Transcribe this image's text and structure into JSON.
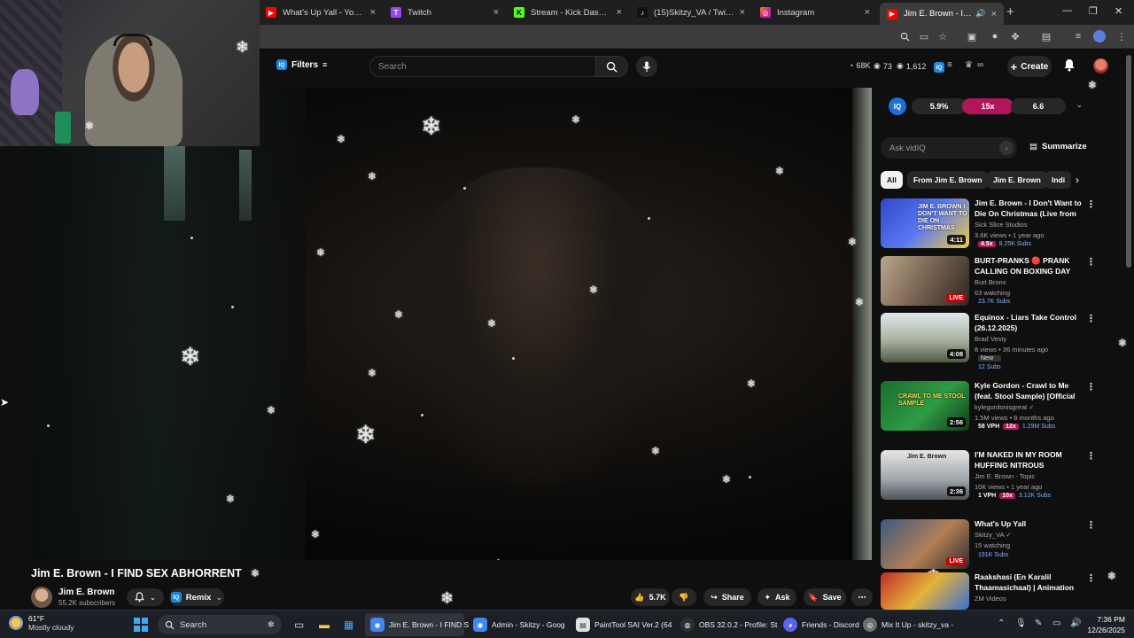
{
  "browser": {
    "tabs": [
      {
        "label": "What's Up Yall - YouTube",
        "favicon": "youtube-icon",
        "color": "#ff0000"
      },
      {
        "label": "Twitch",
        "favicon": "twitch-icon",
        "color": "#9146ff"
      },
      {
        "label": "Stream - Kick Dashboard",
        "favicon": "kick-icon",
        "color": "#53fc18"
      },
      {
        "label": "(15)Skitzy_VA / Twitch and",
        "favicon": "tiktok-icon",
        "color": "#111111"
      },
      {
        "label": "Instagram",
        "favicon": "instagram-icon",
        "color": "#d62976"
      },
      {
        "label": "Jim E. Brown - I FIND S",
        "favicon": "youtube-icon",
        "color": "#ff0000",
        "active": true
      }
    ],
    "new_tab": "+",
    "window_controls": [
      "minimize",
      "maximize",
      "close"
    ]
  },
  "youtube_header": {
    "filters_label": "Filters",
    "search_placeholder": "Search",
    "stats": [
      {
        "icon": "radar-icon",
        "value": "68K"
      },
      {
        "icon": "eye-icon",
        "value": "73"
      },
      {
        "icon": "eye-icon",
        "value": "1,612"
      }
    ],
    "create_label": "Create"
  },
  "video": {
    "title": "Jim E. Brown - I FIND SEX ABHORRENT",
    "channel": "Jim E. Brown",
    "subscribers": "55.2K subscribers",
    "remix_label": "Remix",
    "likes": "5.7K",
    "share_label": "Share",
    "ask_label": "Ask",
    "save_label": "Save"
  },
  "vidiq": {
    "badge": "IQ",
    "metrics": [
      "5.9%",
      "15x",
      "6.6"
    ],
    "ask_placeholder": "Ask vidIQ",
    "summarize_label": "Summarize"
  },
  "chips": [
    "All",
    "From Jim E. Brown",
    "Jim E. Brown",
    "Indi"
  ],
  "recommendations": [
    {
      "title": "Jim E. Brown - I Don't Want to Die On Christmas (Live from ...",
      "channel": "Sick Slice Studios",
      "meta": "3.6K views • 1 year ago",
      "duration": "4:11",
      "badges": [
        "4.5x",
        "8.25K Subs"
      ],
      "thumb_text": "JIM E. BROWN I DON'T WANT TO DIE ON CHRISTMAS"
    },
    {
      "title": "BURT-PRANKS 🔴 PRANK CALLING ON BOXING DAY",
      "channel": "Burt Bronx",
      "meta": "63 watching",
      "duration": "LIVE",
      "badges": [
        "23.7K Subs"
      ],
      "thumb_text": ""
    },
    {
      "title": "Equinox - Liars Take Control (26.12.2025)",
      "channel": "Brad Vesty",
      "meta": "8 views • 36 minutes ago",
      "duration": "4:08",
      "badges": [
        "New",
        "12 Subs"
      ],
      "thumb_text": ""
    },
    {
      "title": "Kyle Gordon - Crawl to Me (feat. Stool Sample) [Official Music ...",
      "channel": "kylegordonisgreat ✓",
      "meta": "1.5M views • 8 months ago",
      "duration": "2:56",
      "badges": [
        "58 VPH",
        "12x",
        "1.29M Subs"
      ],
      "thumb_text": "CRAWL TO ME STOOL SAMPLE"
    },
    {
      "title": "I'M NAKED IN MY ROOM HUFFING NITROUS BALLOONS",
      "channel": "Jim E. Brown - Topic",
      "meta": "10K views • 1 year ago",
      "duration": "2:36",
      "badges": [
        "1 VPH",
        "10x",
        "3.12K Subs"
      ],
      "thumb_text": "Jim E. Brown"
    },
    {
      "title": "What's Up Yall",
      "channel": "Skitzy_VA ✓",
      "meta": "15 watching",
      "duration": "LIVE",
      "badges": [
        "191K Subs"
      ],
      "thumb_text": ""
    },
    {
      "title": "Raakshasi (En Karalil Thaamasichaal) | Animation",
      "channel": "ZM Videos",
      "meta": "",
      "duration": "",
      "badges": [],
      "thumb_text": ""
    }
  ],
  "taskbar": {
    "weather_temp": "61°F",
    "weather_desc": "Mostly cloudy",
    "search_label": "Search",
    "apps": [
      {
        "label": "Jim E. Brown - I FIND S",
        "icon": "chrome-icon",
        "color": "#4285f4",
        "active": true
      },
      {
        "label": "Admin - Skitzy - Goog",
        "icon": "chrome-icon",
        "color": "#4285f4"
      },
      {
        "label": "PaintTool SAI Ver.2 (64",
        "icon": "paint-icon",
        "color": "#e0e0e0"
      },
      {
        "label": "OBS 32.0.2 - Profile: St",
        "icon": "obs-icon",
        "color": "#302e31"
      },
      {
        "label": "Friends - Discord",
        "icon": "discord-icon",
        "color": "#5865f2"
      },
      {
        "label": "Mix It Up - skitzy_va -",
        "icon": "mixitup-icon",
        "color": "#6e6e6e"
      }
    ],
    "time": "7:36 PM",
    "date": "12/26/2025"
  }
}
